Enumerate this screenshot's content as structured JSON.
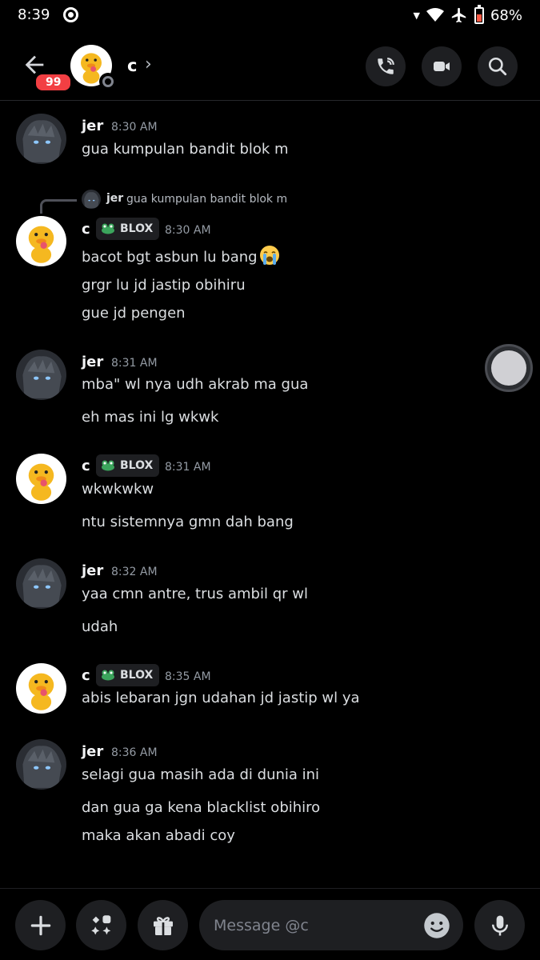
{
  "status_bar": {
    "time": "8:39",
    "battery": "68%"
  },
  "header": {
    "unread_count": "99",
    "contact_name": "c",
    "chevron": "›"
  },
  "messages": [
    {
      "author": "jer",
      "time": "8:30 AM",
      "lines": [
        "gua kumpulan bandit blok m"
      ]
    },
    {
      "reply": {
        "author": "jer",
        "text": "gua kumpulan bandit blok m"
      },
      "author": "c",
      "tag": "BLOX",
      "time": "8:30 AM",
      "lines": [
        "bacot bgt asbun lu bang",
        "grgr lu jd jastip obihiru",
        "gue jd pengen"
      ]
    },
    {
      "author": "jer",
      "time": "8:31 AM",
      "lines": [
        "mba\" wl nya udh akrab ma gua",
        "eh mas ini lg wkwk"
      ]
    },
    {
      "author": "c",
      "tag": "BLOX",
      "time": "8:31 AM",
      "lines": [
        "wkwkwkw",
        "ntu sistemnya gmn dah bang"
      ]
    },
    {
      "author": "jer",
      "time": "8:32 AM",
      "lines": [
        "yaa cmn antre, trus ambil qr wl",
        "udah"
      ]
    },
    {
      "author": "c",
      "tag": "BLOX",
      "time": "8:35 AM",
      "lines": [
        "abis lebaran jgn udahan jd jastip wl ya"
      ]
    },
    {
      "author": "jer",
      "time": "8:36 AM",
      "lines": [
        "selagi gua masih ada di dunia ini",
        "dan gua ga kena blacklist obihiro",
        "maka akan abadi coy"
      ]
    }
  ],
  "composer": {
    "placeholder": "Message @c"
  },
  "icons": {
    "back": "arrow-left-icon",
    "call": "phone-call-icon",
    "video": "video-camera-icon",
    "search": "search-icon",
    "add": "plus-icon",
    "apps": "apps-icon",
    "gift": "gift-icon",
    "emoji": "emoji-icon",
    "mic": "microphone-icon",
    "tag": "frog-icon",
    "reaction": "loudly-crying-emoji"
  },
  "colors": {
    "background": "#000000",
    "badge": "#f23f43",
    "secondary": "#949ba4",
    "surface": "#1e1f22"
  }
}
